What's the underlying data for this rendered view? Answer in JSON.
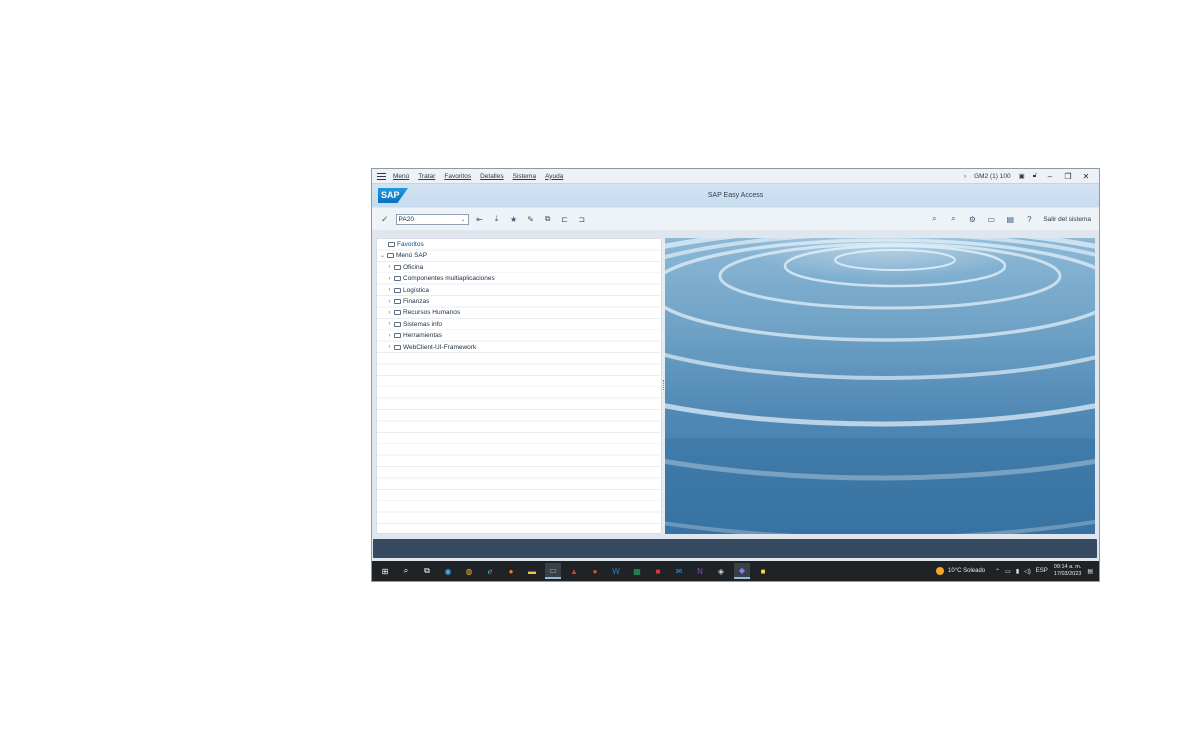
{
  "menubar": {
    "items": [
      "Menú",
      "Tratar",
      "Favoritos",
      "Detalles",
      "Sistema",
      "Ayuda"
    ],
    "system_info": "GM2 (1) 100"
  },
  "titlebar": {
    "logo_text": "SAP",
    "title": "SAP Easy Access"
  },
  "toolbar": {
    "command_value": "PA20",
    "logoff_label": "Salir del sistema"
  },
  "tree": {
    "favorites_label": "Favoritos",
    "root_label": "Menú SAP",
    "items": [
      "Oficina",
      "Componentes multiaplicaciones",
      "Logística",
      "Finanzas",
      "Recursos Humanos",
      "Sistemas info",
      "Herramientas",
      "WebClient-UI-Framework"
    ]
  },
  "taskbar": {
    "weather": "10°C  Soleado",
    "language": "ESP",
    "time": "09:14 a. m.",
    "date": "17/03/2023"
  },
  "colors": {
    "accent": "#0a6fc1",
    "statusbar": "#354a5f",
    "taskbar": "#1f2326"
  }
}
